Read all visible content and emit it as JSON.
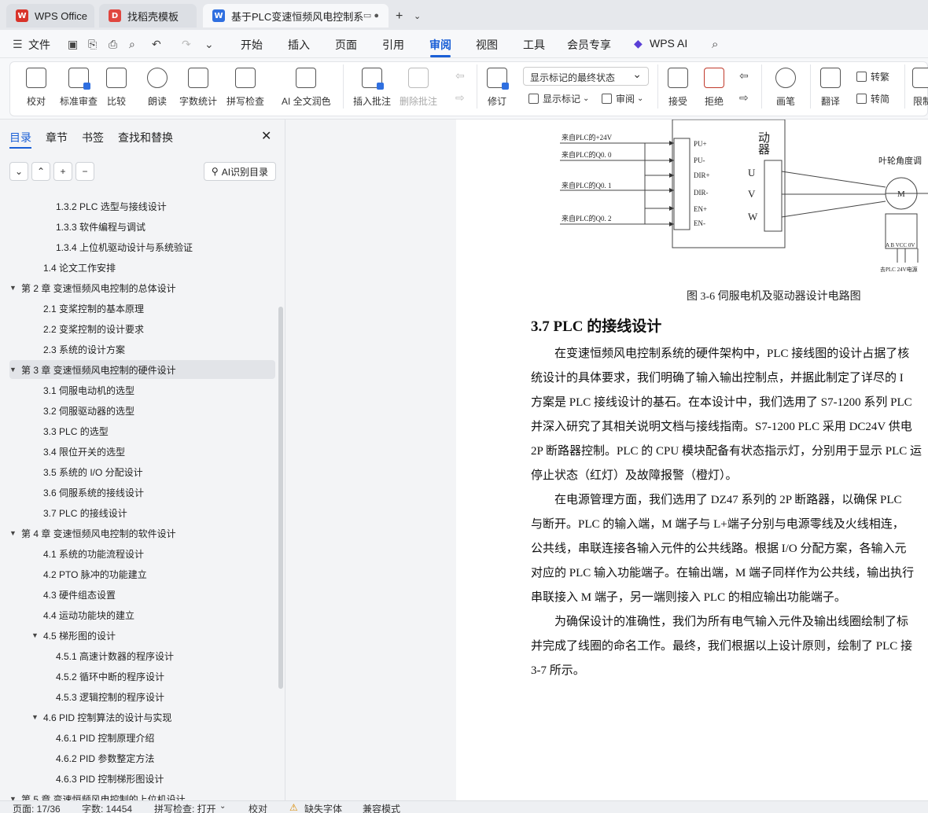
{
  "tabs": [
    {
      "label": "WPS Office"
    },
    {
      "label": "找稻壳模板"
    },
    {
      "label": "基于PLC变速恒频风电控制系"
    }
  ],
  "menu": {
    "file": "文件",
    "items": [
      "开始",
      "插入",
      "页面",
      "引用",
      "审阅",
      "视图",
      "工具",
      "会员专享"
    ],
    "active": "审阅",
    "wps_ai": "WPS AI"
  },
  "ribbon": {
    "proofread": "校对",
    "standard_review": "标准审查",
    "compare": "比较",
    "read_aloud": "朗读",
    "word_count": "字数统计",
    "spell_check": "拼写检查",
    "ai_polish": "AI 全文润色",
    "insert_comment": "插入批注",
    "delete_comment": "删除批注",
    "track_changes": "修订",
    "markup_mode": "显示标记的最终状态",
    "show_markup": "显示标记",
    "review_pane": "审阅",
    "accept": "接受",
    "reject": "拒绝",
    "ink": "画笔",
    "translate": "翻译",
    "to_traditional": "转繁",
    "to_simplified": "转简",
    "restrict": "限制"
  },
  "sidebar": {
    "tabs": [
      "目录",
      "章节",
      "书签",
      "查找和替换"
    ],
    "active_tab": "目录",
    "ai_toc": "AI识别目录",
    "toc": [
      {
        "label": "1.3.2 PLC 选型与接线设计",
        "level": 3
      },
      {
        "label": "1.3.3  软件编程与调试",
        "level": 3
      },
      {
        "label": "1.3.4  上位机驱动设计与系统验证",
        "level": 3
      },
      {
        "label": "1.4  论文工作安排",
        "level": 2
      },
      {
        "label": "第 2 章  变速恒频风电控制的总体设计",
        "level": 1,
        "expanded": true
      },
      {
        "label": "2.1  变桨控制的基本原理",
        "level": 2
      },
      {
        "label": "2.2  变桨控制的设计要求",
        "level": 2
      },
      {
        "label": "2.3  系统的设计方案",
        "level": 2
      },
      {
        "label": "第 3 章  变速恒频风电控制的硬件设计",
        "level": 1,
        "expanded": true,
        "selected": true
      },
      {
        "label": "3.1  伺服电动机的选型",
        "level": 2
      },
      {
        "label": "3.2  伺服驱动器的选型",
        "level": 2
      },
      {
        "label": "3.3 PLC 的选型",
        "level": 2
      },
      {
        "label": "3.4  限位开关的选型",
        "level": 2
      },
      {
        "label": "3.5  系统的 I/O 分配设计",
        "level": 2
      },
      {
        "label": "3.6  伺服系统的接线设计",
        "level": 2
      },
      {
        "label": "3.7 PLC 的接线设计",
        "level": 2
      },
      {
        "label": "第 4 章  变速恒频风电控制的软件设计",
        "level": 1,
        "expanded": true
      },
      {
        "label": "4.1  系统的功能流程设计",
        "level": 2
      },
      {
        "label": "4.2 PTO 脉冲的功能建立",
        "level": 2
      },
      {
        "label": "4.3  硬件组态设置",
        "level": 2
      },
      {
        "label": "4.4  运动功能块的建立",
        "level": 2
      },
      {
        "label": "4.5  梯形图的设计",
        "level": 2,
        "expanded": true
      },
      {
        "label": "4.5.1  高速计数器的程序设计",
        "level": 3
      },
      {
        "label": "4.5.2  循环中断的程序设计",
        "level": 3
      },
      {
        "label": "4.5.3  逻辑控制的程序设计",
        "level": 3
      },
      {
        "label": "4.6 PID 控制算法的设计与实现",
        "level": 2,
        "expanded": true
      },
      {
        "label": "4.6.1 PID 控制原理介绍",
        "level": 3
      },
      {
        "label": "4.6.2 PID 参数整定方法",
        "level": 3
      },
      {
        "label": "4.6.3 PID 控制梯形图设计",
        "level": 3
      },
      {
        "label": "第 5 章  变速恒频风电控制的上位机设计",
        "level": 1,
        "expanded": true
      }
    ]
  },
  "document": {
    "diagram_labels": {
      "src_24v": "来自PLC的+24V",
      "src_q00": "来自PLC的Q0. 0",
      "src_q01": "来自PLC的Q0. 1",
      "src_q02": "来自PLC的Q0. 2",
      "pins": [
        "PU+",
        "PU-",
        "DIR+",
        "DIR-",
        "EN+",
        "EN-"
      ],
      "phases": [
        "U",
        "V",
        "W"
      ],
      "driver_title": "动器",
      "motor_title": "叶轮角度调",
      "motor": "M",
      "terminals": "A B VCC 0V",
      "bottom_note": "去PLC  24V电源"
    },
    "figure_caption": "图 3-6  伺服电机及驱动器设计电路图",
    "heading": "3.7 PLC 的接线设计",
    "paragraphs": [
      "在变速恒频风电控制系统的硬件架构中，PLC 接线图的设计占据了核",
      "统设计的具体要求，我们明确了输入输出控制点，并据此制定了详尽的 I",
      "方案是 PLC 接线设计的基石。在本设计中，我们选用了 S7-1200 系列 PLC",
      "并深入研究了其相关说明文档与接线指南。S7-1200 PLC 采用 DC24V 供电",
      "2P 断路器控制。PLC 的 CPU 模块配备有状态指示灯，分别用于显示 PLC 运",
      "停止状态（红灯）及故障报警（橙灯）。",
      "在电源管理方面，我们选用了 DZ47 系列的 2P 断路器，以确保 PLC",
      "与断开。PLC 的输入端，M 端子与 L+端子分别与电源零线及火线相连，",
      "公共线，串联连接各输入元件的公共线路。根据 I/O 分配方案，各输入元",
      "对应的 PLC 输入功能端子。在输出端，M 端子同样作为公共线，输出执行",
      "串联接入 M 端子，另一端则接入 PLC 的相应输出功能端子。",
      "为确保设计的准确性，我们为所有电气输入元件及输出线圈绘制了标",
      "并完成了线圈的命名工作。最终，我们根据以上设计原则，绘制了 PLC 接",
      "3-7 所示。"
    ]
  },
  "status": {
    "page": "页面: 17/36",
    "words": "字数: 14454",
    "spell": "拼写检查: 打开",
    "proof": "校对",
    "missing_font": "缺失字体",
    "compat": "兼容模式"
  },
  "colors": {
    "accent": "#1a5fd6",
    "wps_red": "#d8332a",
    "docer_red": "#e0463f",
    "doc_blue": "#2f6fe0"
  }
}
